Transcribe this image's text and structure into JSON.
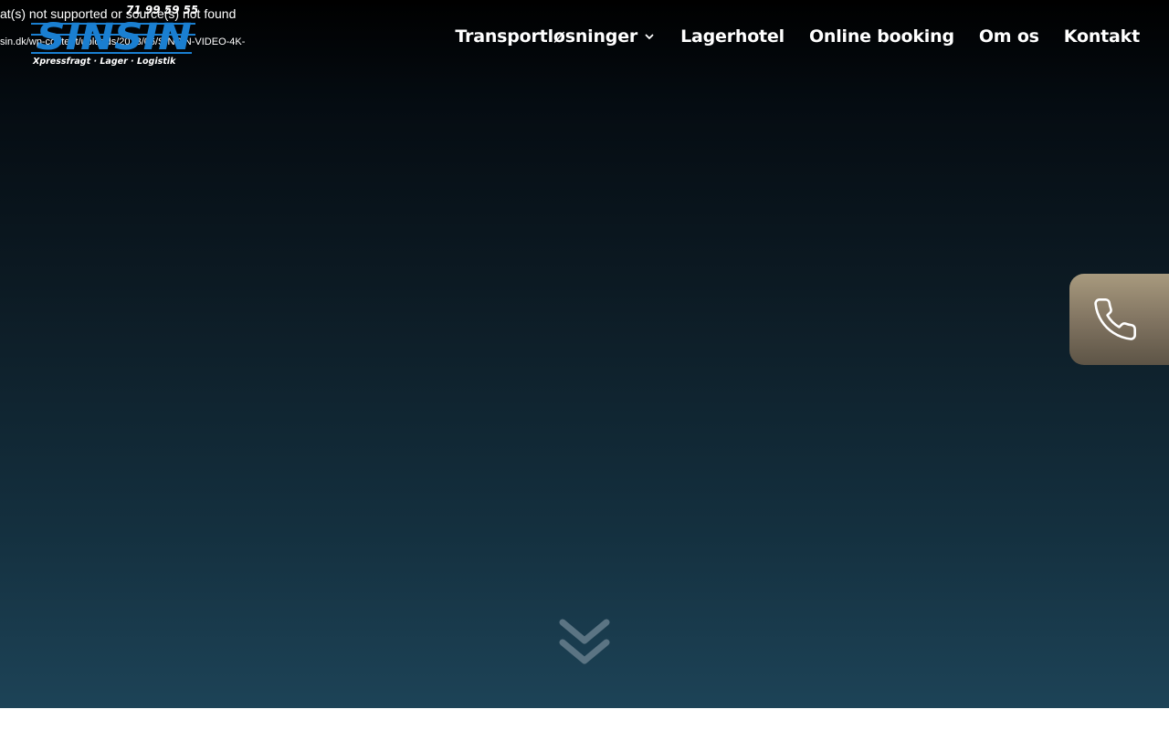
{
  "video_error": {
    "message": "at(s) not supported or source(s) not found",
    "url": "sin.dk/wp-content/uploads/2023/06/SINSIN-VIDEO-4K-"
  },
  "logo": {
    "phone": "71 99 59 55",
    "wordmark": "SINSIN",
    "tagline": "Xpressfragt · Lager · Logistik",
    "color": "#1a7fd1"
  },
  "nav": {
    "items": [
      {
        "label": "Transportløsninger",
        "has_dropdown": true
      },
      {
        "label": "Lagerhotel",
        "has_dropdown": false
      },
      {
        "label": "Online booking",
        "has_dropdown": false
      },
      {
        "label": "Om os",
        "has_dropdown": false
      },
      {
        "label": "Kontakt",
        "has_dropdown": false
      }
    ]
  },
  "call_button": {
    "icon": "phone-icon",
    "accent": "#827562"
  },
  "scroll_down": {
    "icon": "double-chevron-down-icon",
    "color": "#5b7483"
  }
}
